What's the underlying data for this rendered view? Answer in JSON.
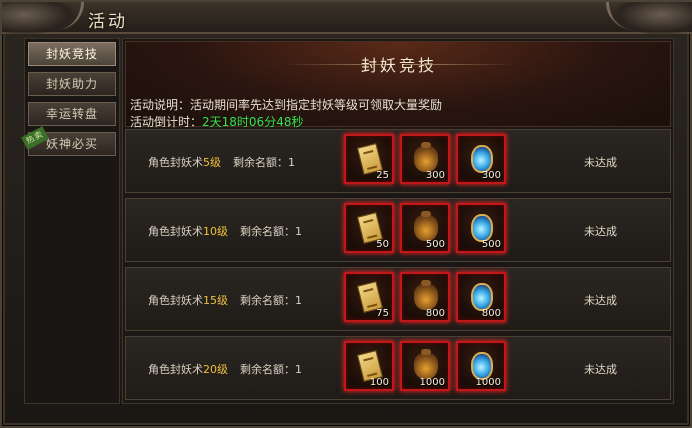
{
  "window": {
    "title": "活动"
  },
  "sidebar": {
    "tabs": [
      {
        "label": "封妖竞技",
        "active": true
      },
      {
        "label": "封妖助力",
        "active": false
      },
      {
        "label": "幸运转盘",
        "active": false
      },
      {
        "label": "妖神必买",
        "active": false,
        "badge": "热卖"
      }
    ]
  },
  "banner": {
    "title": "封妖竞技",
    "description": "活动说明：活动期间率先达到指定封妖等级可领取大量奖励",
    "countdown_label": "活动倒计时：",
    "countdown_value": "2天18时06分48秒"
  },
  "rows": [
    {
      "prefix": "角色封妖术",
      "level": "5级",
      "quota": "剩余名额：1",
      "items": [
        {
          "icon": "scroll-icon",
          "count": "25"
        },
        {
          "icon": "bag-icon",
          "count": "300"
        },
        {
          "icon": "potion-icon",
          "count": "300"
        }
      ],
      "status": "未达成"
    },
    {
      "prefix": "角色封妖术",
      "level": "10级",
      "quota": "剩余名额：1",
      "items": [
        {
          "icon": "scroll-icon",
          "count": "50"
        },
        {
          "icon": "bag-icon",
          "count": "500"
        },
        {
          "icon": "potion-icon",
          "count": "500"
        }
      ],
      "status": "未达成"
    },
    {
      "prefix": "角色封妖术",
      "level": "15级",
      "quota": "剩余名额：1",
      "items": [
        {
          "icon": "scroll-icon",
          "count": "75"
        },
        {
          "icon": "bag-icon",
          "count": "800"
        },
        {
          "icon": "potion-icon",
          "count": "800"
        }
      ],
      "status": "未达成"
    },
    {
      "prefix": "角色封妖术",
      "level": "20级",
      "quota": "剩余名额：1",
      "items": [
        {
          "icon": "scroll-icon",
          "count": "100"
        },
        {
          "icon": "bag-icon",
          "count": "1000"
        },
        {
          "icon": "potion-icon",
          "count": "1000"
        }
      ],
      "status": "未达成"
    }
  ],
  "colors": {
    "accent_green": "#32e050",
    "level_yellow": "#f0c040",
    "item_border_red": "#c0181a"
  }
}
